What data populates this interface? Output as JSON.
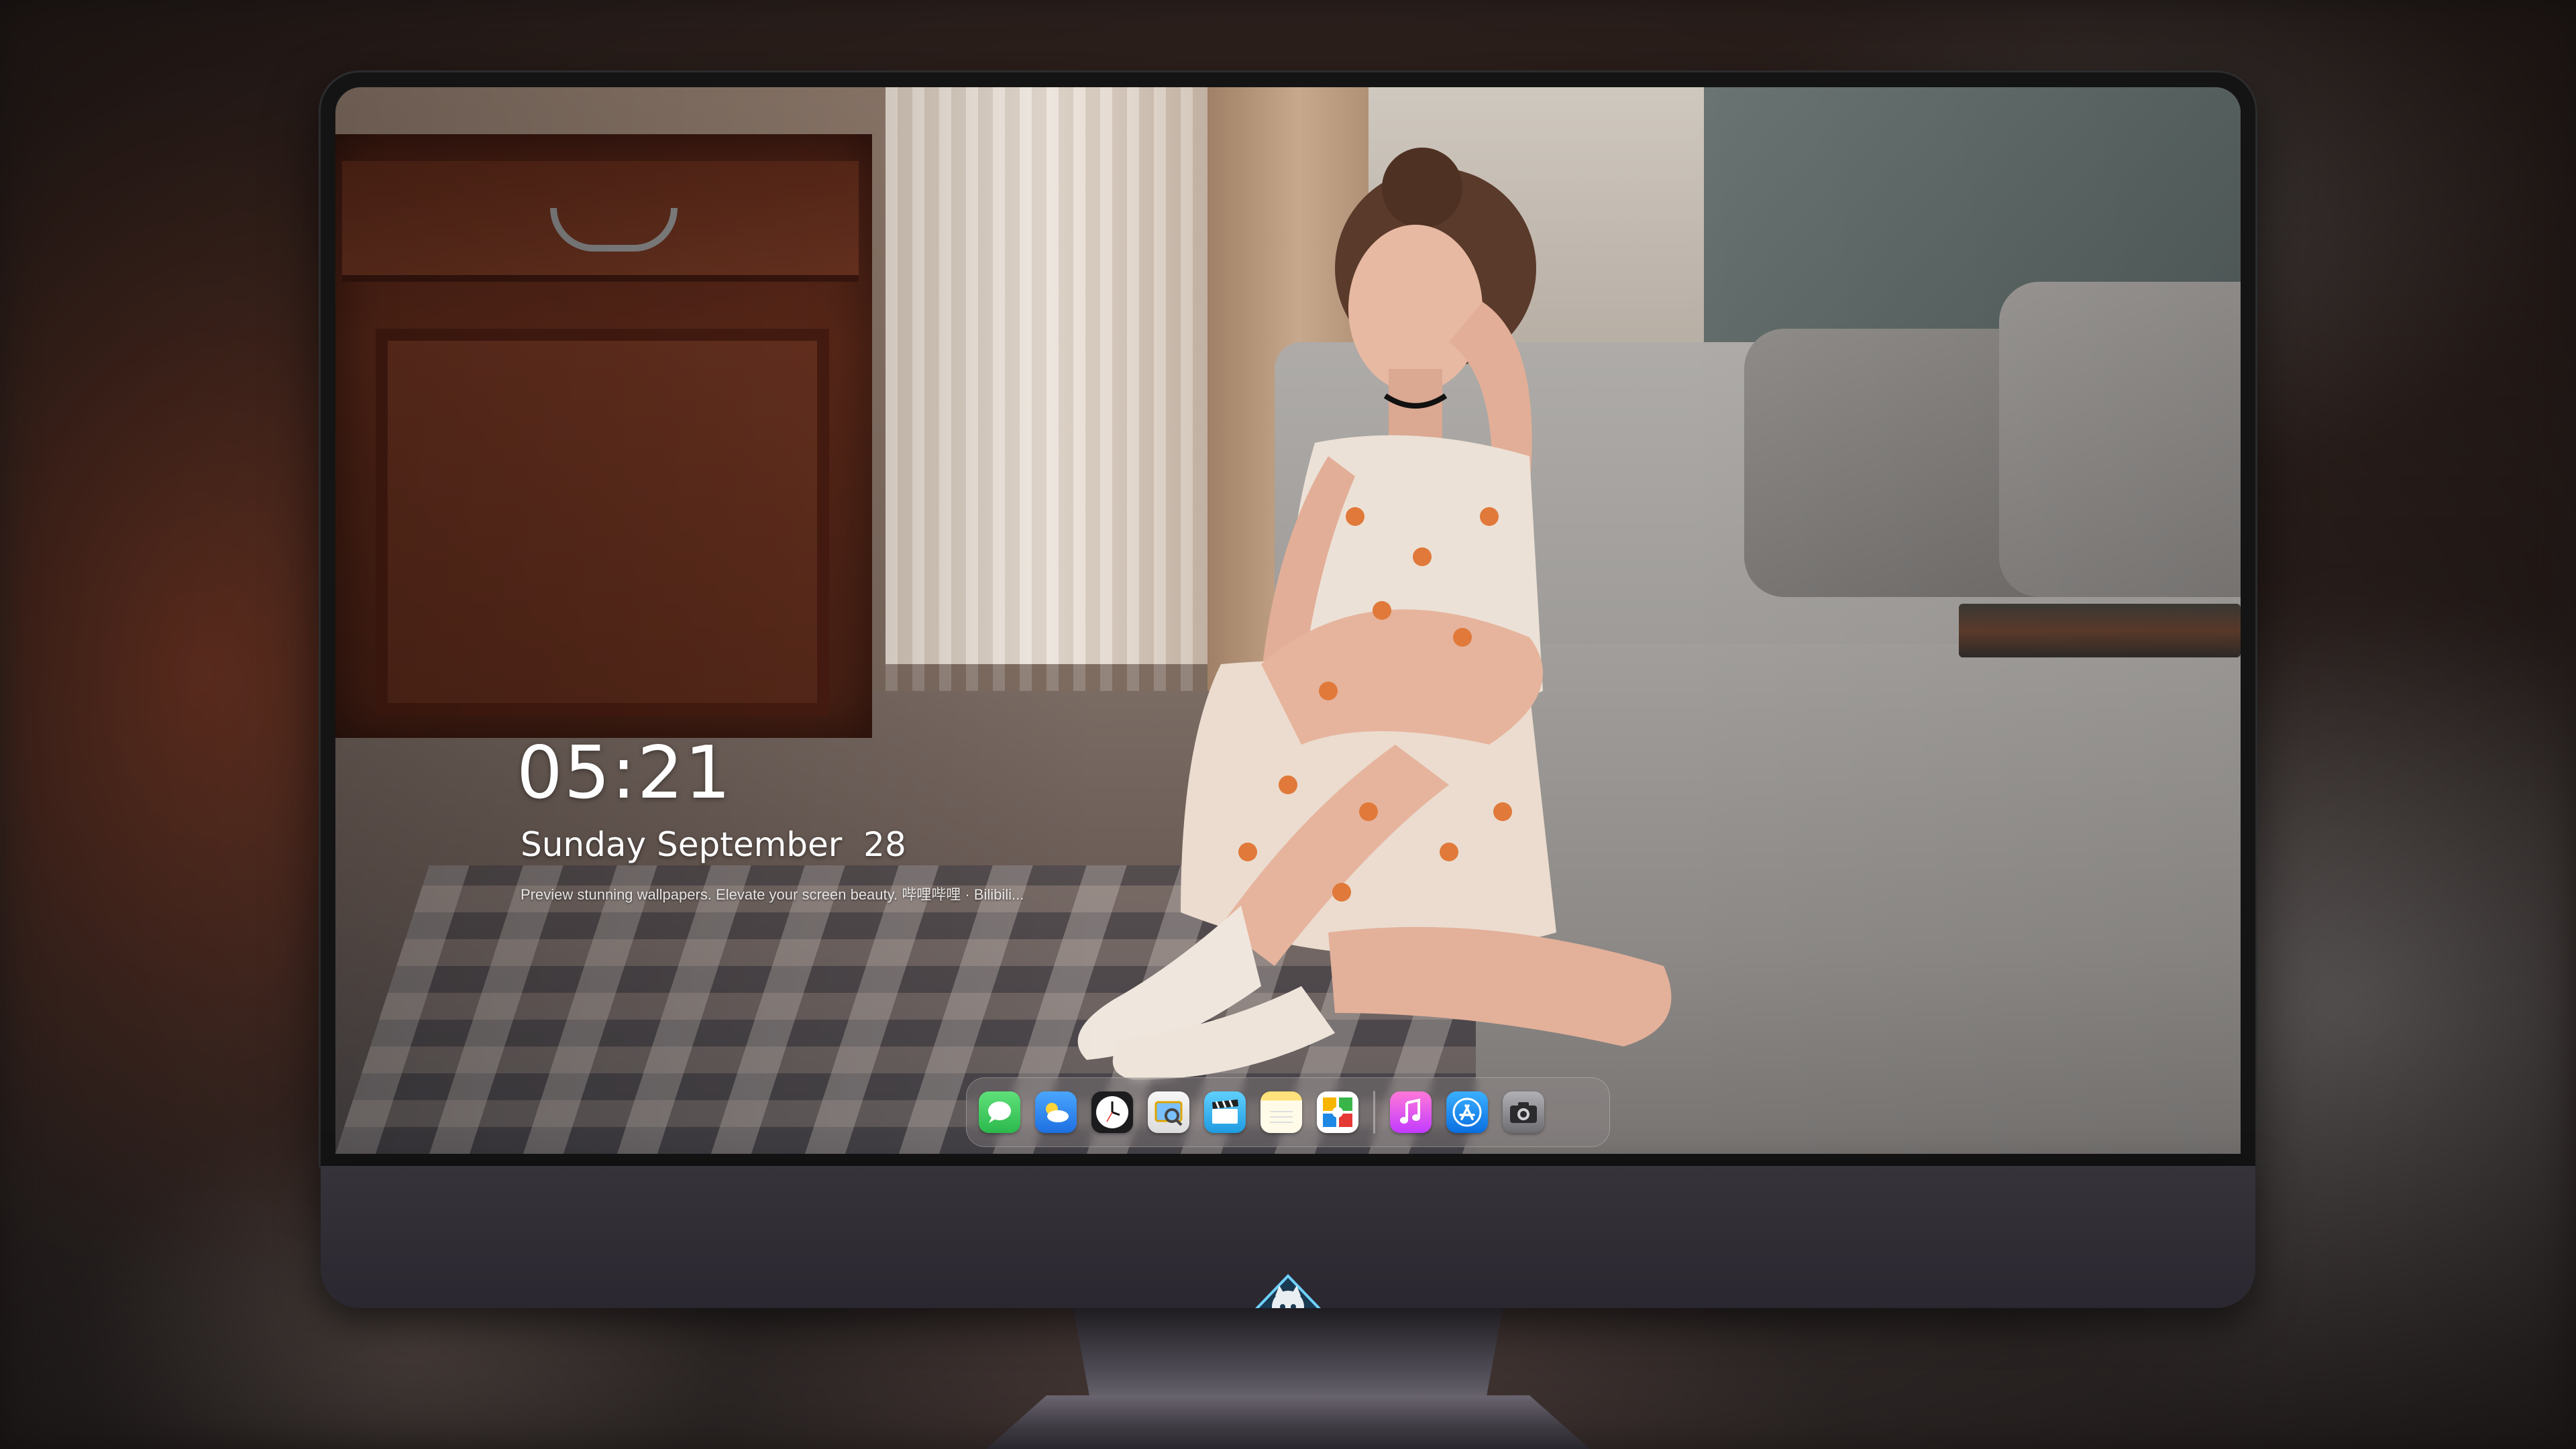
{
  "lockscreen": {
    "time": "05:21",
    "date": "Sunday September  28",
    "tagline": "Preview stunning wallpapers. Elevate your screen beauty. 哔哩哔哩 · Bilibili..."
  },
  "dock": {
    "apps": [
      {
        "name": "Messages",
        "icon": "messages-icon",
        "color": "#34c759"
      },
      {
        "name": "Weather",
        "icon": "weather-icon",
        "color": "#2f8bf5"
      },
      {
        "name": "Clock",
        "icon": "clock-icon",
        "color": "#1c1c1e"
      },
      {
        "name": "Preview",
        "icon": "preview-icon",
        "color": "#f2f2f2"
      },
      {
        "name": "Clips",
        "icon": "clapperboard-icon",
        "color": "#3fb4f0"
      },
      {
        "name": "Notes",
        "icon": "notes-icon",
        "color": "#ffd84a"
      },
      {
        "name": "Photos Gallery",
        "icon": "gallery-icon",
        "color": "#ffffff"
      },
      {
        "name": "Music",
        "icon": "music-icon",
        "color": "#fb5bc5"
      },
      {
        "name": "App Store",
        "icon": "app-store-icon",
        "color": "#1a8cf3"
      },
      {
        "name": "Camera",
        "icon": "camera-icon",
        "color": "#8e8e93"
      }
    ]
  },
  "monitor": {
    "logo_icon": "mascot-logo-icon"
  }
}
